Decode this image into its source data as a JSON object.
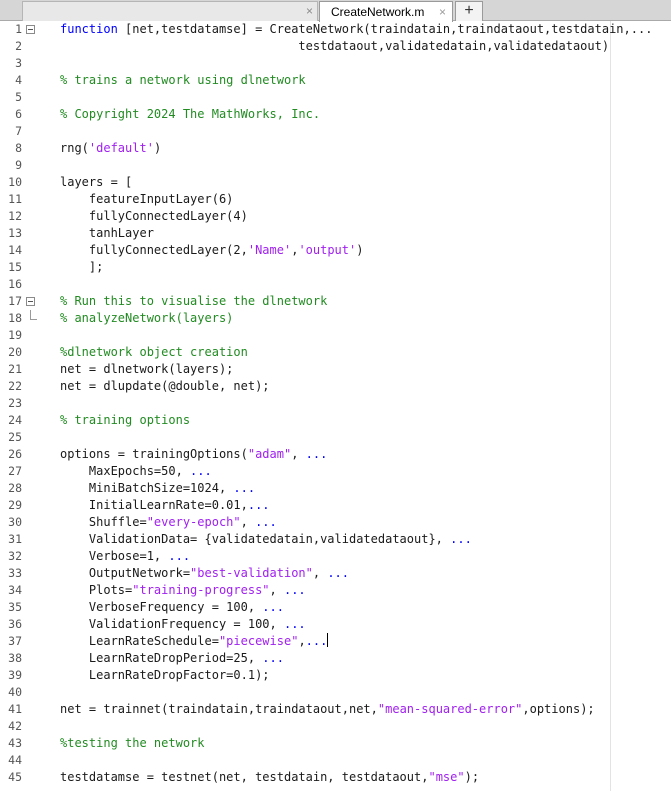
{
  "tabs": {
    "previous_close": "×",
    "active_label": "CreateNetwork.m",
    "active_close": "×",
    "add": "+"
  },
  "code_lines": [
    {
      "n": "1",
      "fold": "start",
      "segs": [
        {
          "t": "function",
          "c": "kw"
        },
        {
          "t": " [net,testdatamse] = CreateNetwork(traindatain,traindataout,testdatain,...",
          "c": ""
        }
      ]
    },
    {
      "n": "2",
      "segs": [
        {
          "t": "                                 testdataout,validatedatain,validatedataout)",
          "c": ""
        }
      ]
    },
    {
      "n": "3",
      "segs": []
    },
    {
      "n": "4",
      "segs": [
        {
          "t": "% trains a network using dlnetwork",
          "c": "cm"
        }
      ]
    },
    {
      "n": "5",
      "segs": []
    },
    {
      "n": "6",
      "segs": [
        {
          "t": "% Copyright 2024 The MathWorks, Inc.",
          "c": "cm"
        }
      ]
    },
    {
      "n": "7",
      "segs": []
    },
    {
      "n": "8",
      "segs": [
        {
          "t": "rng(",
          "c": ""
        },
        {
          "t": "'default'",
          "c": "st"
        },
        {
          "t": ")",
          "c": ""
        }
      ]
    },
    {
      "n": "9",
      "segs": []
    },
    {
      "n": "10",
      "segs": [
        {
          "t": "layers = [",
          "c": ""
        }
      ]
    },
    {
      "n": "11",
      "segs": [
        {
          "t": "    featureInputLayer(6)",
          "c": ""
        }
      ]
    },
    {
      "n": "12",
      "segs": [
        {
          "t": "    fullyConnectedLayer(4)",
          "c": ""
        }
      ]
    },
    {
      "n": "13",
      "segs": [
        {
          "t": "    tanhLayer",
          "c": ""
        }
      ]
    },
    {
      "n": "14",
      "segs": [
        {
          "t": "    fullyConnectedLayer(2,",
          "c": ""
        },
        {
          "t": "'Name'",
          "c": "st"
        },
        {
          "t": ",",
          "c": ""
        },
        {
          "t": "'output'",
          "c": "st"
        },
        {
          "t": ")",
          "c": ""
        }
      ]
    },
    {
      "n": "15",
      "segs": [
        {
          "t": "    ];",
          "c": ""
        }
      ]
    },
    {
      "n": "16",
      "segs": []
    },
    {
      "n": "17",
      "fold": "start",
      "segs": [
        {
          "t": "% Run this to visualise the dlnetwork",
          "c": "cm"
        }
      ]
    },
    {
      "n": "18",
      "fold": "end",
      "segs": [
        {
          "t": "% analyzeNetwork(layers)",
          "c": "cm"
        }
      ]
    },
    {
      "n": "19",
      "segs": []
    },
    {
      "n": "20",
      "segs": [
        {
          "t": "%dlnetwork object creation",
          "c": "cm"
        }
      ]
    },
    {
      "n": "21",
      "segs": [
        {
          "t": "net = dlnetwork(layers);",
          "c": ""
        }
      ]
    },
    {
      "n": "22",
      "segs": [
        {
          "t": "net = dlupdate(@double, net);",
          "c": ""
        }
      ]
    },
    {
      "n": "23",
      "segs": []
    },
    {
      "n": "24",
      "segs": [
        {
          "t": "% training options",
          "c": "cm"
        }
      ]
    },
    {
      "n": "25",
      "segs": []
    },
    {
      "n": "26",
      "segs": [
        {
          "t": "options = trainingOptions(",
          "c": ""
        },
        {
          "t": "\"adam\"",
          "c": "st"
        },
        {
          "t": ", ",
          "c": ""
        },
        {
          "t": "...",
          "c": "kw"
        }
      ]
    },
    {
      "n": "27",
      "segs": [
        {
          "t": "    MaxEpochs=50, ",
          "c": ""
        },
        {
          "t": "...",
          "c": "kw"
        }
      ]
    },
    {
      "n": "28",
      "segs": [
        {
          "t": "    MiniBatchSize=1024, ",
          "c": ""
        },
        {
          "t": "...",
          "c": "kw"
        }
      ]
    },
    {
      "n": "29",
      "segs": [
        {
          "t": "    InitialLearnRate=0.01,",
          "c": ""
        },
        {
          "t": "...",
          "c": "kw"
        }
      ]
    },
    {
      "n": "30",
      "segs": [
        {
          "t": "    Shuffle=",
          "c": ""
        },
        {
          "t": "\"every-epoch\"",
          "c": "st"
        },
        {
          "t": ", ",
          "c": ""
        },
        {
          "t": "...",
          "c": "kw"
        }
      ]
    },
    {
      "n": "31",
      "segs": [
        {
          "t": "    ValidationData= {validatedatain,validatedataout}, ",
          "c": ""
        },
        {
          "t": "...",
          "c": "kw"
        }
      ]
    },
    {
      "n": "32",
      "segs": [
        {
          "t": "    Verbose=1, ",
          "c": ""
        },
        {
          "t": "...",
          "c": "kw"
        }
      ]
    },
    {
      "n": "33",
      "segs": [
        {
          "t": "    OutputNetwork=",
          "c": ""
        },
        {
          "t": "\"best-validation\"",
          "c": "st"
        },
        {
          "t": ", ",
          "c": ""
        },
        {
          "t": "...",
          "c": "kw"
        }
      ]
    },
    {
      "n": "34",
      "segs": [
        {
          "t": "    Plots=",
          "c": ""
        },
        {
          "t": "\"training-progress\"",
          "c": "st"
        },
        {
          "t": ", ",
          "c": ""
        },
        {
          "t": "...",
          "c": "kw"
        }
      ]
    },
    {
      "n": "35",
      "segs": [
        {
          "t": "    VerboseFrequency = 100, ",
          "c": ""
        },
        {
          "t": "...",
          "c": "kw"
        }
      ]
    },
    {
      "n": "36",
      "segs": [
        {
          "t": "    ValidationFrequency = 100, ",
          "c": ""
        },
        {
          "t": "...",
          "c": "kw"
        }
      ]
    },
    {
      "n": "37",
      "cursor": true,
      "segs": [
        {
          "t": "    LearnRateSchedule=",
          "c": ""
        },
        {
          "t": "\"piecewise\"",
          "c": "st"
        },
        {
          "t": ",",
          "c": ""
        },
        {
          "t": "...",
          "c": "kw"
        }
      ]
    },
    {
      "n": "38",
      "segs": [
        {
          "t": "    LearnRateDropPeriod=25, ",
          "c": ""
        },
        {
          "t": "...",
          "c": "kw"
        }
      ]
    },
    {
      "n": "39",
      "segs": [
        {
          "t": "    LearnRateDropFactor=0.1);",
          "c": ""
        }
      ]
    },
    {
      "n": "40",
      "segs": []
    },
    {
      "n": "41",
      "segs": [
        {
          "t": "net = trainnet(traindatain,traindataout,net,",
          "c": ""
        },
        {
          "t": "\"mean-squared-error\"",
          "c": "st"
        },
        {
          "t": ",options);",
          "c": ""
        }
      ]
    },
    {
      "n": "42",
      "segs": []
    },
    {
      "n": "43",
      "segs": [
        {
          "t": "%testing the network",
          "c": "cm"
        }
      ]
    },
    {
      "n": "44",
      "segs": []
    },
    {
      "n": "45",
      "segs": [
        {
          "t": "testdatamse = testnet(net, testdatain, testdataout,",
          "c": ""
        },
        {
          "t": "\"mse\"",
          "c": "st"
        },
        {
          "t": ");",
          "c": ""
        }
      ]
    }
  ]
}
